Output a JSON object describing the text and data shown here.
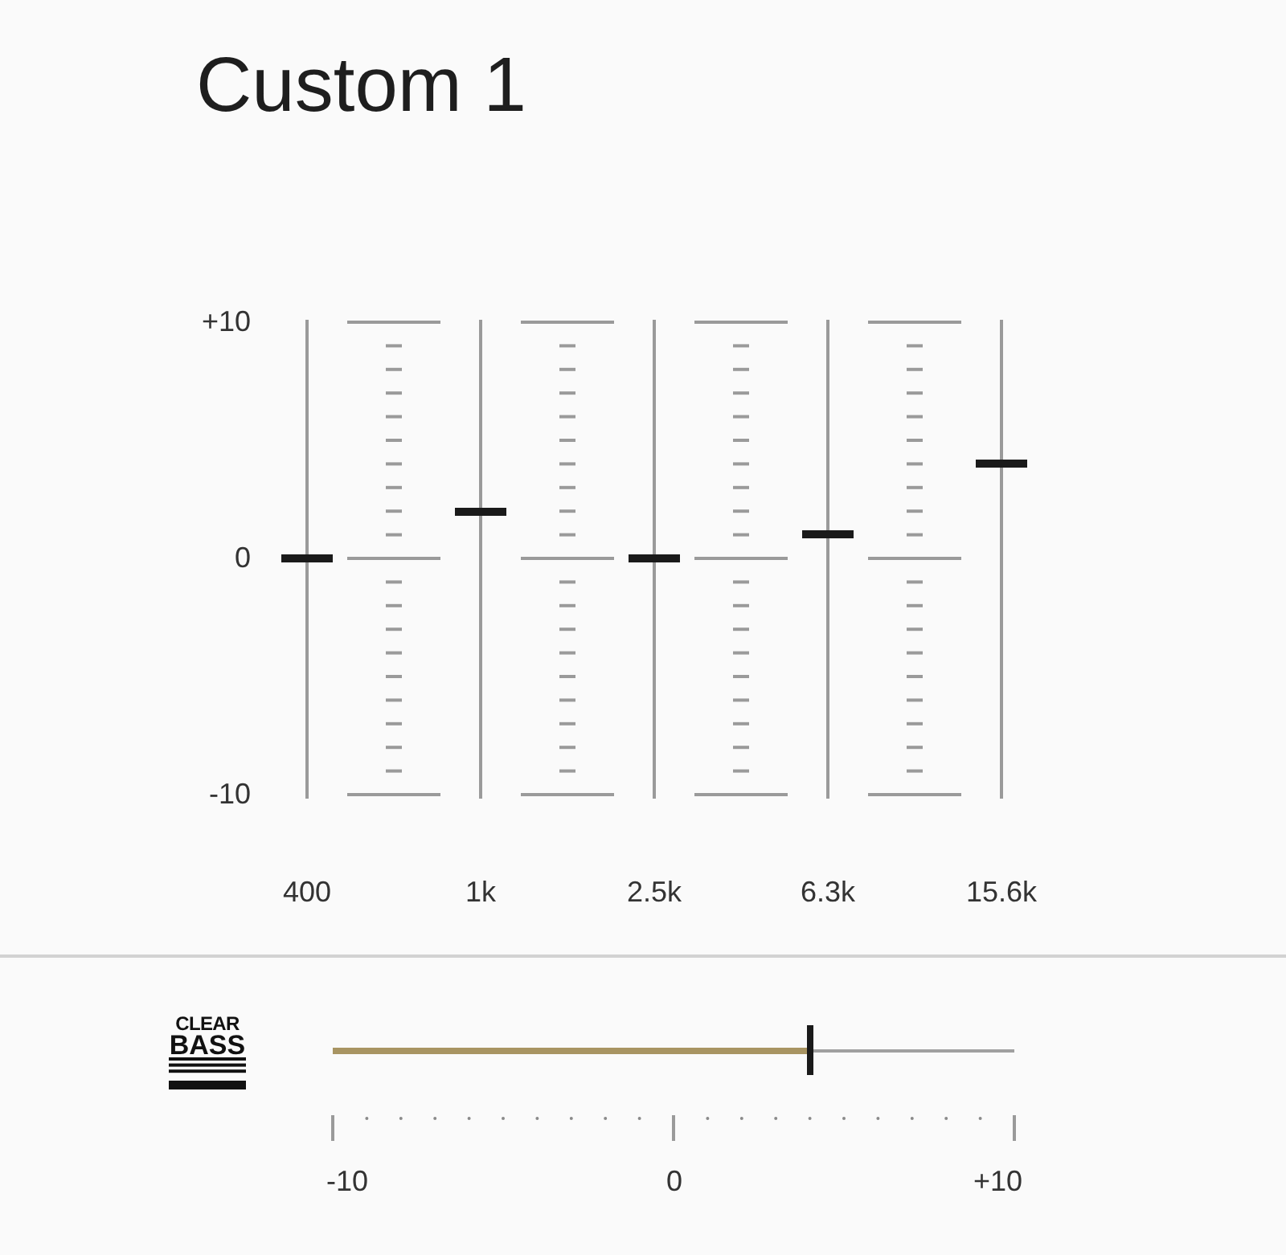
{
  "title": "Custom 1",
  "equalizer": {
    "scale_labels": [
      "+10",
      "0",
      "-10"
    ],
    "bands": [
      {
        "label": "400",
        "level": 0.5
      },
      {
        "label": "1k",
        "level": 0.6
      },
      {
        "label": "2.5k",
        "level": 0.5
      },
      {
        "label": "6.3k",
        "level": 0.55
      },
      {
        "label": "15.6k",
        "level": 0.7
      }
    ]
  },
  "clear_bass": {
    "logo": [
      "CLEAR",
      "BASS"
    ],
    "level": 0.7,
    "scale_labels": [
      "-10",
      "0",
      "+10"
    ]
  }
}
